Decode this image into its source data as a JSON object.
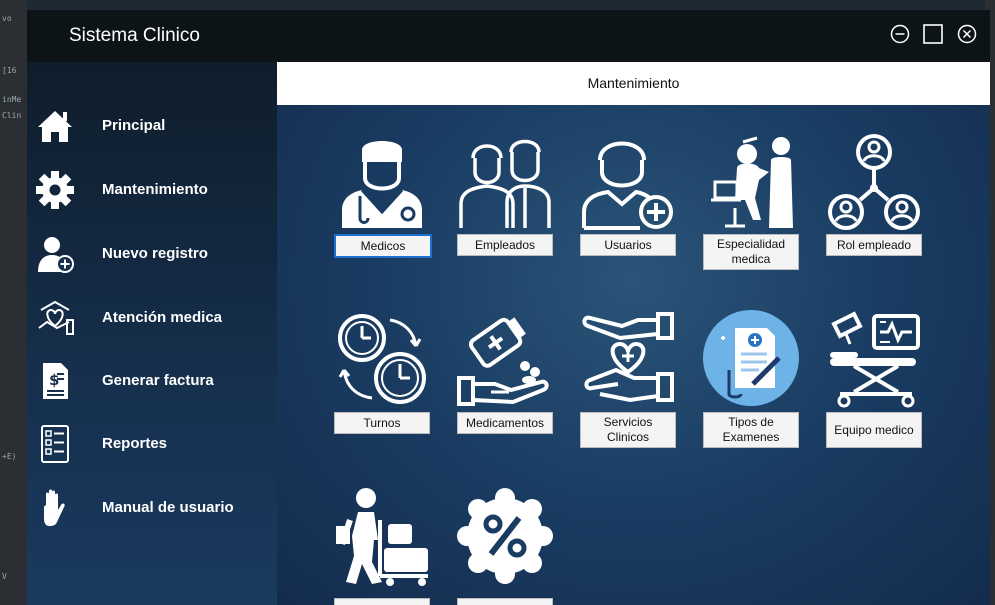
{
  "app": {
    "title": "Sistema Clinico"
  },
  "window_controls": {
    "minimize": "minimize-icon",
    "maximize": "maximize-icon",
    "close": "close-icon"
  },
  "sidebar": {
    "items": [
      {
        "label": "Principal",
        "icon": "home-icon"
      },
      {
        "label": "Mantenimiento",
        "icon": "gear-icon"
      },
      {
        "label": "Nuevo registro",
        "icon": "add-user-icon"
      },
      {
        "label": "Atención medica",
        "icon": "medical-care-icon"
      },
      {
        "label": "Generar factura",
        "icon": "invoice-icon"
      },
      {
        "label": "Reportes",
        "icon": "report-icon"
      },
      {
        "label": "Manual de usuario",
        "icon": "hand-icon"
      }
    ]
  },
  "main": {
    "header": "Mantenimiento",
    "tiles": [
      {
        "label": "Medicos",
        "icon": "doctor-icon",
        "selected": true
      },
      {
        "label": "Empleados",
        "icon": "employees-icon"
      },
      {
        "label": "Usuarios",
        "icon": "user-add-icon"
      },
      {
        "label": "Especialidad medica",
        "icon": "specialty-icon"
      },
      {
        "label": "Rol empleado",
        "icon": "role-network-icon"
      },
      {
        "label": "Turnos",
        "icon": "shift-clock-icon"
      },
      {
        "label": "Medicamentos",
        "icon": "medicine-icon"
      },
      {
        "label": "Servicios Clinicos",
        "icon": "clinical-services-icon"
      },
      {
        "label": "Tipos de Examenes",
        "icon": "exam-types-icon"
      },
      {
        "label": "Equipo medico",
        "icon": "medical-equipment-icon"
      },
      {
        "label": "",
        "icon": "delivery-icon"
      },
      {
        "label": "",
        "icon": "discount-icon"
      }
    ]
  },
  "ide_background": {
    "left_text": [
      "vo",
      "[16",
      "inMe",
      "Clin",
      "+E)",
      "V"
    ]
  },
  "colors": {
    "titlebar": "#0d1418",
    "sidebar": "#16304e",
    "main_bg": "#1a3c62",
    "button_bg": "#f4f4f4",
    "selected_border": "#1e6fd0"
  }
}
